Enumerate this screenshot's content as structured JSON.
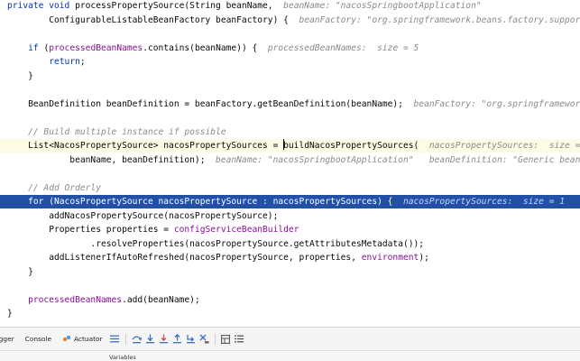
{
  "editor": {
    "lines": [
      {
        "segments": [
          {
            "t": "private void ",
            "c": "kw"
          },
          {
            "t": "processPropertySource(String beanName,  "
          },
          {
            "t": "beanName: \"nacosSpringbootApplication\"",
            "c": "inl"
          }
        ]
      },
      {
        "segments": [
          {
            "t": "        ConfigurableListableBeanFactory beanFactory) {  "
          },
          {
            "t": "beanFactory: \"org.springframework.beans.factory.support.Defa",
            "c": "inl"
          }
        ]
      },
      {
        "segments": []
      },
      {
        "segments": [
          {
            "t": "    "
          },
          {
            "t": "if",
            "c": "kw"
          },
          {
            "t": " ("
          },
          {
            "t": "processedBeanNames",
            "c": "fld"
          },
          {
            "t": ".contains(beanName)) {  "
          },
          {
            "t": "processedBeanNames:  size = 5",
            "c": "inl"
          }
        ]
      },
      {
        "segments": [
          {
            "t": "        "
          },
          {
            "t": "return",
            "c": "kw"
          },
          {
            "t": ";"
          }
        ]
      },
      {
        "segments": [
          {
            "t": "    }"
          }
        ]
      },
      {
        "segments": []
      },
      {
        "segments": [
          {
            "t": "    BeanDefinition beanDefinition = beanFactory.getBeanDefinition(beanName);  "
          },
          {
            "t": "beanFactory: \"org.springframework.bea",
            "c": "inl"
          }
        ]
      },
      {
        "segments": []
      },
      {
        "segments": [
          {
            "t": "    "
          },
          {
            "t": "// Build multiple instance if possible",
            "c": "cm"
          }
        ]
      },
      {
        "style": "exec",
        "segments": [
          {
            "t": "    List<NacosPropertySource> nacosPropertySources = "
          },
          {
            "t": "|",
            "c": "caret"
          },
          {
            "t": "buildNacosPropertySources(  "
          },
          {
            "t": "nacosPropertySources:  size = 1",
            "c": "inl"
          }
        ]
      },
      {
        "segments": [
          {
            "t": "            beanName, beanDefinition);  "
          },
          {
            "t": "beanName: \"nacosSpringbootApplication\"   beanDefinition: \"Generic bean: clos",
            "c": "inl"
          }
        ]
      },
      {
        "segments": []
      },
      {
        "segments": [
          {
            "t": "    "
          },
          {
            "t": "// Add Orderly",
            "c": "cm"
          }
        ]
      },
      {
        "style": "sel",
        "segments": [
          {
            "t": "    "
          },
          {
            "t": "for",
            "c": "kw"
          },
          {
            "t": " (NacosPropertySource nacosPropertySource : nacosPropertySources) {  "
          },
          {
            "t": "nacosPropertySources:  size = 1",
            "c": "inl"
          }
        ]
      },
      {
        "segments": [
          {
            "t": "        addNacosPropertySource(nacosPropertySource);"
          }
        ]
      },
      {
        "segments": [
          {
            "t": "        Properties properties = "
          },
          {
            "t": "configServiceBeanBuilder",
            "c": "fld"
          }
        ]
      },
      {
        "segments": [
          {
            "t": "                .resolveProperties(nacosPropertySource.getAttributesMetadata());"
          }
        ]
      },
      {
        "segments": [
          {
            "t": "        addListenerIfAutoRefreshed(nacosPropertySource, properties, "
          },
          {
            "t": "environment",
            "c": "fld"
          },
          {
            "t": ");"
          }
        ]
      },
      {
        "segments": [
          {
            "t": "    }"
          }
        ]
      },
      {
        "segments": []
      },
      {
        "segments": [
          {
            "t": "    "
          },
          {
            "t": "processedBeanNames",
            "c": "fld"
          },
          {
            "t": ".add(beanName);"
          }
        ]
      },
      {
        "segments": [
          {
            "t": "}"
          }
        ]
      }
    ]
  },
  "toolbar": {
    "tabs": {
      "debugger": "ugger",
      "console": "Console",
      "actuator": "Actuator"
    },
    "icons": [
      "layout-icon",
      "step-over-icon",
      "step-into-icon",
      "force-step-into-icon",
      "step-out-icon",
      "run-to-cursor-icon",
      "evaluate-icon",
      "table-icon",
      "settings-list-icon"
    ]
  },
  "footer": {
    "variables_label": "Variables"
  },
  "colors": {
    "keyword": "#0033b3",
    "field": "#871094",
    "comment": "#8c8c8c",
    "selection": "#2150a6",
    "exec_line": "#fdfbe4"
  }
}
